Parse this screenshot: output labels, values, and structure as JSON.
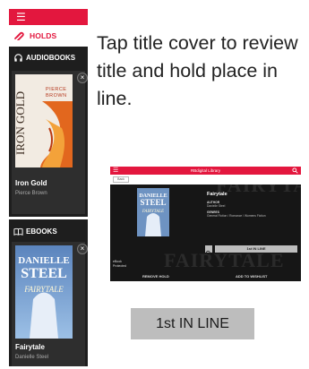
{
  "phone": {
    "holds_label": "HOLDS",
    "audiobooks_label": "AUDIOBOOKS",
    "ebooks_label": "EBOOKS",
    "audiobook": {
      "title": "Iron Gold",
      "author": "Pierce Brown",
      "cover_title": "IRON GOLD",
      "cover_author": "PIERCE BROWN"
    },
    "ebook": {
      "title": "Fairytale",
      "author": "Danielle Steel",
      "cover_author_1": "DANIELLE",
      "cover_author_2": "STEEL",
      "cover_title": "FAIRYTALE"
    },
    "close_glyph": "×",
    "menu_glyph": "☰"
  },
  "instruction": "Tap title cover to review title and hold place in line.",
  "desktop": {
    "app_title": "RBdigital Library",
    "back_label": "Back",
    "book_title": "Fairytale",
    "author_label": "AUTHOR",
    "author_value": "Danielle Steel",
    "genres_label": "GENRES",
    "genres_value": "General Fiction / Romance / Womens Fiction",
    "cover_author_1": "DANIELLE",
    "cover_author_2": "STEEL",
    "cover_title": "FAIRYTALE",
    "line_button": "1st IN LINE",
    "format_1": "eBook",
    "format_2": "Protected",
    "remove_hold": "REMOVE HOLD",
    "add_wishlist": "ADD TO WISHLIST",
    "bg_word": "FAIRYTALE"
  },
  "badge": "1st IN LINE",
  "colors": {
    "accent": "#e3173e",
    "dark": "#1e1e1e",
    "button_gray": "#bdbdbd"
  }
}
